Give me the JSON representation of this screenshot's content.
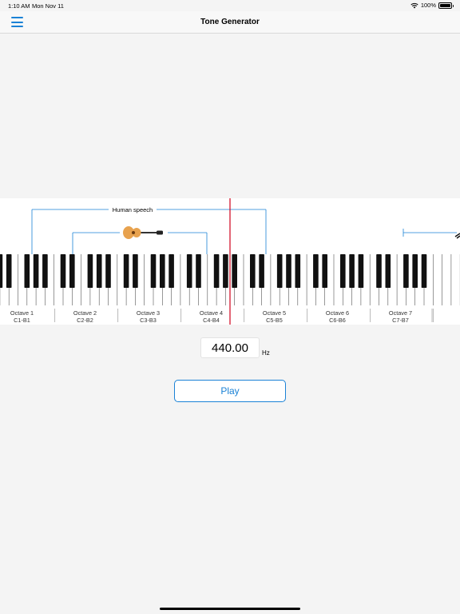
{
  "status_bar": {
    "time": "1:10 AM",
    "date": "Mon Nov 11",
    "battery": "100%"
  },
  "nav": {
    "title": "Tone Generator",
    "menu_icon": "hamburger-menu-icon"
  },
  "keyboard": {
    "range_label": "Human speech",
    "octaves": [
      {
        "name": "Octave 1",
        "range": "C1-B1"
      },
      {
        "name": "Octave 2",
        "range": "C2-B2"
      },
      {
        "name": "Octave 3",
        "range": "C3-B3"
      },
      {
        "name": "Octave 4",
        "range": "C4-B4"
      },
      {
        "name": "Octave 5",
        "range": "C5-B5"
      },
      {
        "name": "Octave 6",
        "range": "C6-B6"
      },
      {
        "name": "Octave 7",
        "range": "C7-B7"
      }
    ],
    "selected_frequency_hz": 440,
    "colors": {
      "range_line": "#1a82d6",
      "marker": "#d0021b",
      "guitar_body": "#e8a24e"
    },
    "icons": [
      "guitar-icon"
    ]
  },
  "frequency": {
    "value": "440.00",
    "unit": "Hz"
  },
  "play_button": {
    "label": "Play"
  },
  "colors": {
    "accent": "#1a82d6",
    "background": "#f4f4f4"
  }
}
